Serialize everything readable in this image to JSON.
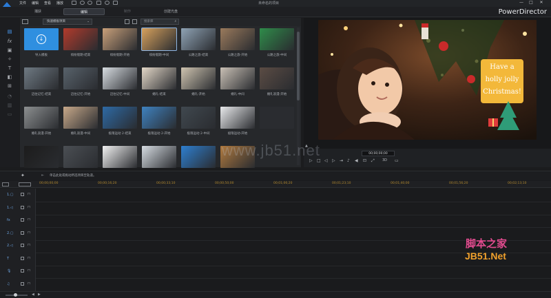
{
  "titlebar": {
    "menu": [
      "文件",
      "编辑",
      "查看",
      "播放"
    ],
    "window_title": "未命名的项目",
    "win_buttons": [
      "—",
      "□",
      "✕"
    ]
  },
  "modebar": {
    "tabs": [
      "捕获",
      "编辑",
      "制作",
      "创建光盘"
    ],
    "active_tab": "编辑",
    "brand": "PowerDirector"
  },
  "library": {
    "dropdown_label": "快速模板项目",
    "search_placeholder": "搜索库",
    "items": [
      {
        "label": "导入模板",
        "color": "#2f8fe0"
      },
      {
        "label": "缤纷假期-结束",
        "color": "#b23b2c"
      },
      {
        "label": "缤纷假期-开始",
        "color": "#c9a07a"
      },
      {
        "label": "缤纷假期-中间",
        "color": "#d7a15d"
      },
      {
        "label": "公路之旅-结束",
        "color": "#8fa3b5"
      },
      {
        "label": "公路之旅-开始",
        "color": "#9a7a5c"
      },
      {
        "label": "公路之旅-中间",
        "color": "#2f8c4a"
      },
      {
        "label": "迈往记忆-结束",
        "color": "#6f7a83"
      },
      {
        "label": "迈往记忆-开始",
        "color": "#58626b"
      },
      {
        "label": "迈往记忆-中间",
        "color": "#d8dde2"
      },
      {
        "label": "婚礼-结束",
        "color": "#e4d8c8"
      },
      {
        "label": "婚礼-开始",
        "color": "#cfc4b0"
      },
      {
        "label": "婚礼-中间",
        "color": "#c9c0b5"
      },
      {
        "label": "婚礼浪漫-开始",
        "color": "#5b4c44"
      },
      {
        "label": "婚礼浪漫-开始",
        "color": "#8c8f90"
      },
      {
        "label": "婚礼浪漫-中间",
        "color": "#c8a98a"
      },
      {
        "label": "极限运动 2-结束",
        "color": "#2e6aa5"
      },
      {
        "label": "极限运动 2-开始",
        "color": "#3f82c0"
      },
      {
        "label": "极限运动 2-中间",
        "color": "#40484f"
      },
      {
        "label": "极限运动-开始",
        "color": "#e9eaec"
      },
      {
        "label": "",
        "color": "#2a2c30"
      },
      {
        "label": "",
        "color": "#1c1c1c"
      },
      {
        "label": "",
        "color": "#4b4f54"
      },
      {
        "label": "",
        "color": "#f2f2f2"
      },
      {
        "label": "",
        "color": "#d6dce2"
      },
      {
        "label": "",
        "color": "#2e7fd0"
      },
      {
        "label": "",
        "color": "#b07a3f"
      }
    ]
  },
  "preview": {
    "card_line1": "Have a",
    "card_line2": "holly jolly",
    "card_line3": "Christmas!",
    "timecode": "00;00;00;00",
    "mode_3d": "3D"
  },
  "midbar": {
    "hint": "单击此处或拖动所选项目至轨道。"
  },
  "timeline": {
    "ticks": [
      "00;00;00;00",
      "00;00;16;20",
      "00;00;33;10",
      "00;00;50;00",
      "00;01;06;20",
      "00;01;23;10",
      "00;01;40;00",
      "00;01;56;20",
      "00;02;13;10",
      "00;02;30;00",
      "00;02;46;20",
      "00;03;03;10"
    ],
    "tracks": [
      {
        "label": "1.▢"
      },
      {
        "label": "1.◁"
      },
      {
        "label": "fx"
      },
      {
        "label": "2.▢"
      },
      {
        "label": "2.◁"
      },
      {
        "label": "T"
      },
      {
        "label": "🎙"
      },
      {
        "label": "♫"
      }
    ]
  },
  "watermark": {
    "site": "www.jb51.net",
    "logo_top": "脚本之家",
    "logo_bottom": "JB51.Net"
  }
}
